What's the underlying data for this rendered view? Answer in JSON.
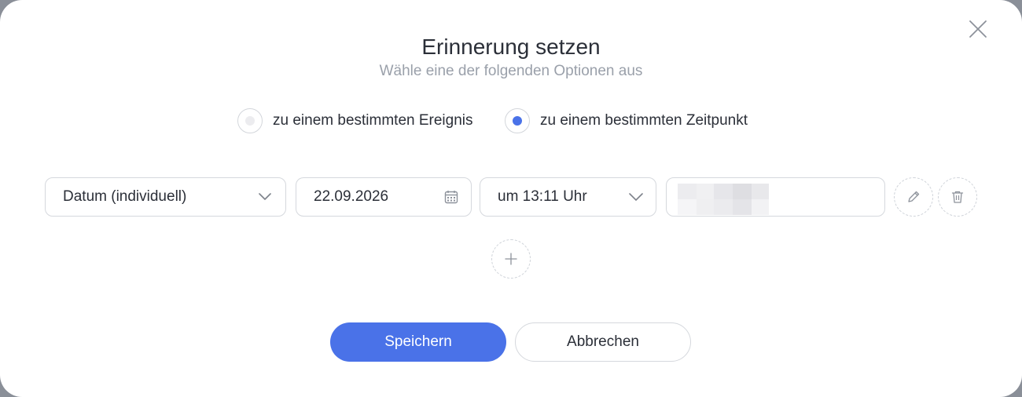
{
  "dialog": {
    "title": "Erinnerung setzen",
    "subtitle": "Wähle eine der folgenden Optionen aus",
    "close_icon": "close-icon"
  },
  "options": [
    {
      "label": "zu einem bestimmten Ereignis",
      "selected": false
    },
    {
      "label": "zu einem bestimmten Zeitpunkt",
      "selected": true
    }
  ],
  "reminder_row": {
    "date_type": "Datum (individuell)",
    "date": "22.09.2026",
    "time": "um 13:11 Uhr",
    "recipient": "",
    "icons": {
      "date_type": "chevron-down-icon",
      "date": "calendar-icon",
      "time": "chevron-down-icon",
      "edit": "pencil-icon",
      "delete": "trash-icon",
      "add": "plus-icon"
    }
  },
  "actions": {
    "save_label": "Speichern",
    "cancel_label": "Abbrechen"
  },
  "colors": {
    "accent": "#4a72e8",
    "border": "#d5d8dd",
    "subtitle": "#9aa0aa"
  }
}
